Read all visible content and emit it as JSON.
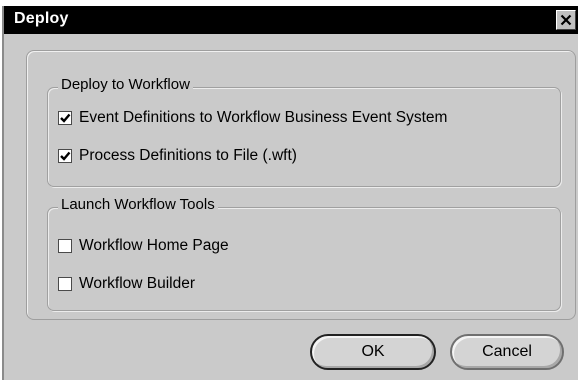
{
  "dialog": {
    "title": "Deploy",
    "close_icon": "close-icon"
  },
  "deploy_group": {
    "legend": "Deploy to Workflow",
    "options": [
      {
        "label": "Event Definitions to Workflow Business Event System",
        "checked": true
      },
      {
        "label": "Process Definitions to File (.wft)",
        "checked": true
      }
    ]
  },
  "launch_group": {
    "legend": "Launch Workflow Tools",
    "options": [
      {
        "label": "Workflow Home Page",
        "checked": false
      },
      {
        "label": "Workflow Builder",
        "checked": false
      }
    ]
  },
  "buttons": {
    "ok_label": "OK",
    "cancel_label": "Cancel"
  },
  "colors": {
    "titlebar": "#000000",
    "dialog_bg": "#cacaca",
    "title_text": "#ffffff"
  }
}
